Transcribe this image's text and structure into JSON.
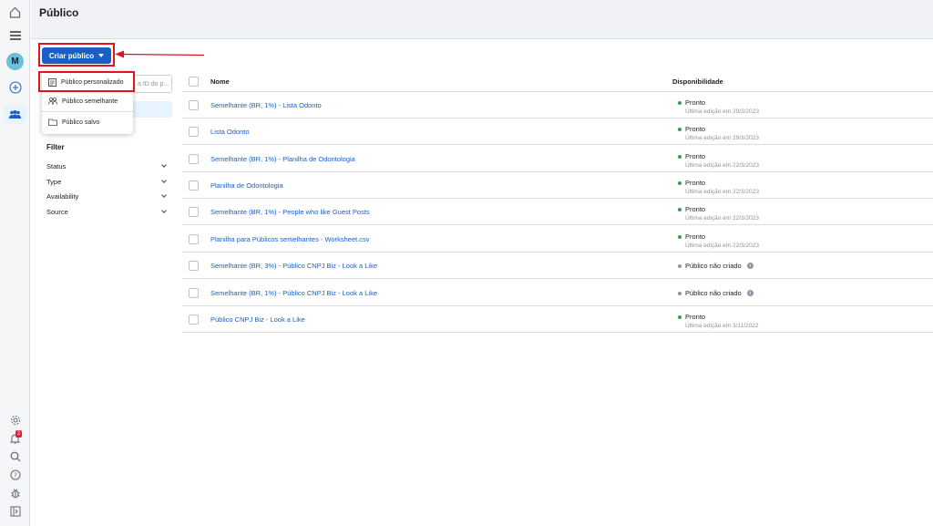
{
  "header": {
    "title": "Público"
  },
  "sidebar": {
    "avatar_letter": "M",
    "notif_count": "2"
  },
  "toolbar": {
    "create_label": "Criar público"
  },
  "search": {
    "placeholder": "a ID do p..."
  },
  "create_menu": {
    "items": [
      {
        "label": "Público personalizado",
        "icon": "custom-audience-icon"
      },
      {
        "label": "Público semelhante",
        "icon": "people-icon"
      },
      {
        "label": "Público salvo",
        "icon": "folder-icon"
      }
    ]
  },
  "filters": {
    "title": "Filter",
    "items": [
      "Status",
      "Type",
      "Availability",
      "Source"
    ]
  },
  "table": {
    "columns": {
      "name": "Nome",
      "availability": "Disponibilidade"
    },
    "rows": [
      {
        "name": "Semelhante (BR, 1%) - Lista Odonto",
        "status": "Pronto",
        "edited": "Última edição em 29/3/2023",
        "state": "ready"
      },
      {
        "name": "Lista Odonto",
        "status": "Pronto",
        "edited": "Última edição em 29/3/2023",
        "state": "ready"
      },
      {
        "name": "Semelhante (BR, 1%) - Planilha de Odontologia",
        "status": "Pronto",
        "edited": "Última edição em 22/3/2023",
        "state": "ready"
      },
      {
        "name": "Planilha de Odontologia",
        "status": "Pronto",
        "edited": "Última edição em 22/3/2023",
        "state": "ready"
      },
      {
        "name": "Semelhante (BR, 1%) - People who like Guest Posts",
        "status": "Pronto",
        "edited": "Última edição em 22/3/2023",
        "state": "ready"
      },
      {
        "name": "Planilha para Públicos semelhantes - Worksheet.csv",
        "status": "Pronto",
        "edited": "Última edição em 22/3/2023",
        "state": "ready"
      },
      {
        "name": "Semelhante (BR, 3%) - Público CNPJ Biz - Look a Like",
        "status": "Público não criado",
        "edited": "",
        "state": "not_created"
      },
      {
        "name": "Semelhante (BR, 1%) - Público CNPJ Biz - Look a Like",
        "status": "Público não criado",
        "edited": "",
        "state": "not_created"
      },
      {
        "name": "Público CNPJ Biz - Look a Like",
        "status": "Pronto",
        "edited": "Última edição em 3/11/2022",
        "state": "ready"
      }
    ]
  },
  "colors": {
    "accent": "#1a5fc7",
    "ready": "#31a24c",
    "not_created": "#8d949e",
    "highlight": "#e0141e"
  }
}
